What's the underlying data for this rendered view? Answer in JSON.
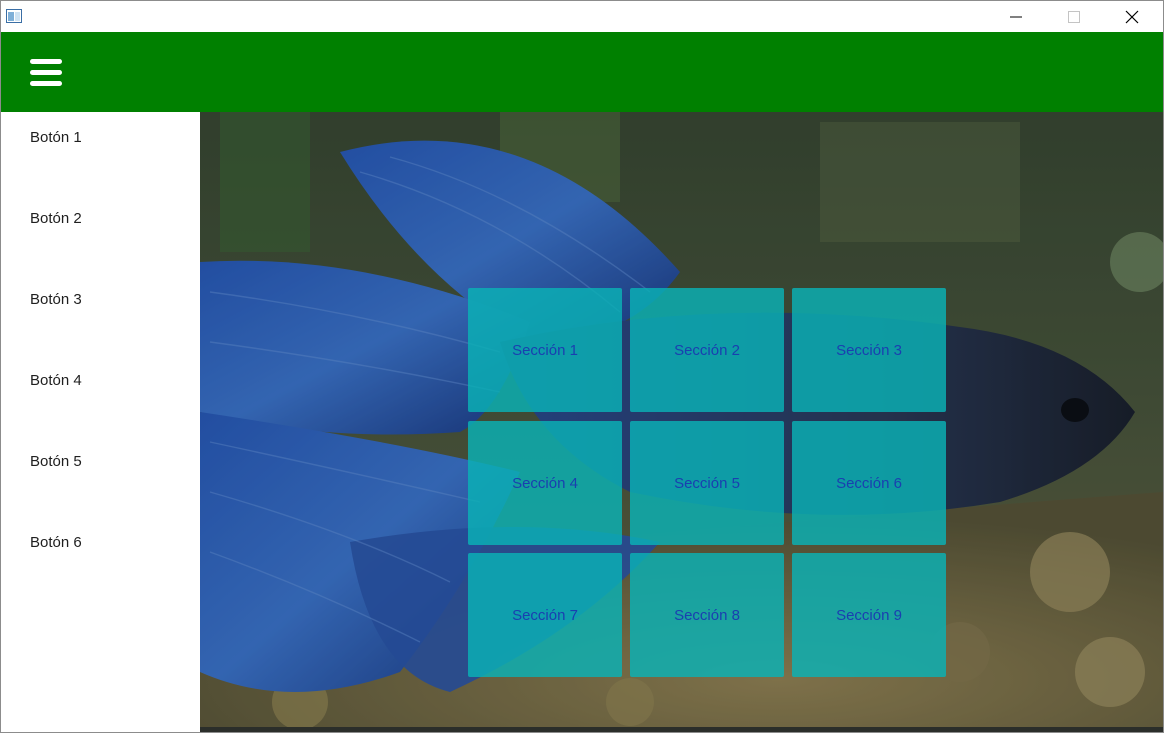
{
  "window": {
    "controls": {
      "minimize_icon": "minimize-icon",
      "maximize_icon": "maximize-icon",
      "close_icon": "close-icon"
    }
  },
  "header": {
    "color": "#008000",
    "menu_icon": "hamburger-menu-icon"
  },
  "sidebar": {
    "items": [
      {
        "label": "Botón 1"
      },
      {
        "label": "Botón 2"
      },
      {
        "label": "Botón 3"
      },
      {
        "label": "Botón 4"
      },
      {
        "label": "Botón 5"
      },
      {
        "label": "Botón 6"
      }
    ]
  },
  "main": {
    "background": "betta-fish-aquarium-photo",
    "tile_color": "#0ab2b6",
    "tile_text_color": "#1a3fb0",
    "sections": [
      {
        "label": "Sección 1"
      },
      {
        "label": "Sección 2"
      },
      {
        "label": "Sección 3"
      },
      {
        "label": "Sección 4"
      },
      {
        "label": "Sección 5"
      },
      {
        "label": "Sección 6"
      },
      {
        "label": "Sección 7"
      },
      {
        "label": "Sección 8"
      },
      {
        "label": "Sección 9"
      }
    ]
  }
}
